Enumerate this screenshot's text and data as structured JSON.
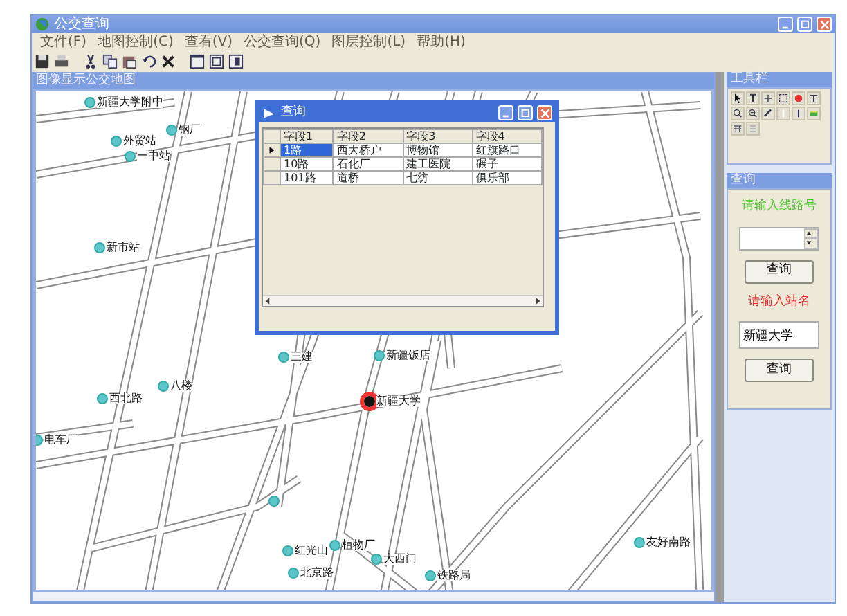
{
  "window": {
    "title": "公交查询"
  },
  "menu": [
    "文件(F)",
    "地图控制(C)",
    "查看(V)",
    "公交查询(Q)",
    "图层控制(L)",
    "帮助(H)"
  ],
  "map_window": {
    "title": "图像显示公交地图"
  },
  "stops": [
    {
      "label": "新疆大学附中",
      "selected": false
    },
    {
      "label": "外贸站",
      "selected": false
    },
    {
      "label": "钢厂",
      "selected": false
    },
    {
      "label": "一中站",
      "selected": false
    },
    {
      "label": "新市站",
      "selected": false
    },
    {
      "label": "三建",
      "selected": false
    },
    {
      "label": "八楼",
      "selected": false
    },
    {
      "label": "西北路",
      "selected": false
    },
    {
      "label": "电车厂",
      "selected": false
    },
    {
      "label": "新疆饭店",
      "selected": false
    },
    {
      "label": "新疆大学",
      "selected": true
    },
    {
      "selected": false
    },
    {
      "label": "植物厂",
      "selected": false
    },
    {
      "label": "红光山",
      "selected": false
    },
    {
      "label": "大西门",
      "selected": false
    },
    {
      "label": "北京路",
      "selected": false
    },
    {
      "label": "友好南路",
      "selected": false
    },
    {
      "label": "铁路局",
      "selected": false
    }
  ],
  "dialog": {
    "title": "查询",
    "columns": [
      "字段1",
      "字段2",
      "字段3",
      "字段4"
    ],
    "rows": [
      {
        "cells": [
          "1路",
          "西大桥户",
          "博物馆",
          "红旗路口"
        ],
        "selected": true
      },
      {
        "cells": [
          "10路",
          "石化厂",
          "建工医院",
          "碾子"
        ],
        "selected": false
      },
      {
        "cells": [
          "101路",
          "道桥",
          "七纺",
          "俱乐部"
        ],
        "selected": false
      }
    ]
  },
  "toolbox": {
    "title": "工具栏"
  },
  "query_panel": {
    "title": "查询",
    "line_label": "请输入线路号",
    "line_button": "查询",
    "station_label": "请输入站名",
    "station_value": "新疆大学",
    "station_button": "查询"
  }
}
